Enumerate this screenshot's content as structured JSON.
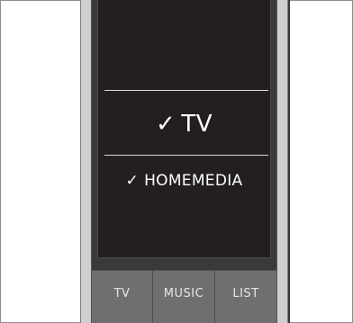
{
  "screen": {
    "selected_item": {
      "check": "✓",
      "label": "TV"
    },
    "secondary_item": {
      "check": "✓",
      "label": "HOMEMEDIA"
    }
  },
  "softkeys": [
    {
      "label": "TV"
    },
    {
      "label": "MUSIC"
    },
    {
      "label": "LIST"
    }
  ],
  "colors": {
    "screen_background": "#231f20",
    "bezel": "#cfcfcf",
    "softkey_bar": "#6f6f6f",
    "text": "#ffffff"
  }
}
